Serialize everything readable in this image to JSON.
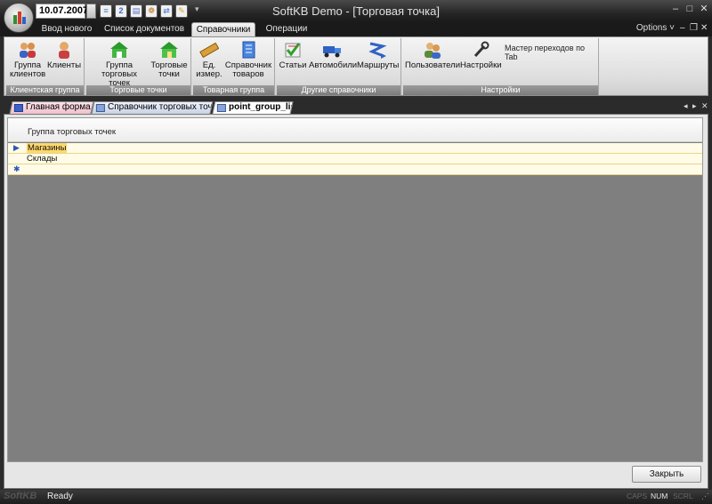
{
  "window": {
    "title": "SoftKB Demo - [Торговая точка]",
    "date": "10.07.2007",
    "minimize": "–",
    "maximize": "□",
    "close": "✕"
  },
  "quick_access": {
    "items": [
      {
        "icon": "document-icon",
        "glyph": "≡",
        "color": "#4f7fd8"
      },
      {
        "icon": "refresh-icon",
        "glyph": "2",
        "color": "#3a6bd0"
      },
      {
        "icon": "print-icon",
        "glyph": "▤",
        "color": "#5577cc"
      },
      {
        "icon": "settings-icon",
        "glyph": "❁",
        "color": "#c07a20"
      },
      {
        "icon": "export-icon",
        "glyph": "⇄",
        "color": "#5a88d8"
      },
      {
        "icon": "notes-icon",
        "glyph": "✎",
        "color": "#d4a32a"
      }
    ],
    "dropdown": "▾"
  },
  "ribbon": {
    "tabs": [
      {
        "label": "Ввод нового"
      },
      {
        "label": "Список документов"
      },
      {
        "label": "Справочники",
        "active": true
      },
      {
        "label": "Операции"
      }
    ],
    "options_label": "Options ˅",
    "mdi_min": "–",
    "mdi_restore": "❐",
    "mdi_close": "✕",
    "groups": [
      {
        "label": "Клиентская группа",
        "buttons": [
          {
            "label1": "Группа",
            "label2": "клиентов",
            "icon": "users-icon"
          },
          {
            "label1": "Клиенты",
            "label2": "",
            "icon": "client-icon"
          }
        ]
      },
      {
        "label": "Торговые точки",
        "buttons": [
          {
            "label1": "Группа",
            "label2": "торговых точек",
            "icon": "store-group-icon"
          },
          {
            "label1": "Торговые",
            "label2": "точки",
            "icon": "store-icon"
          }
        ]
      },
      {
        "label": "Товарная группа",
        "buttons": [
          {
            "label1": "Ед.",
            "label2": "измер.",
            "icon": "ruler-icon"
          },
          {
            "label1": "Справочник",
            "label2": "товаров",
            "icon": "catalog-icon"
          }
        ]
      },
      {
        "label": "Другие справочники",
        "buttons": [
          {
            "label1": "Статьи",
            "label2": "",
            "icon": "articles-icon"
          },
          {
            "label1": "Автомобили",
            "label2": "",
            "icon": "truck-icon"
          },
          {
            "label1": "Маршруты",
            "label2": "",
            "icon": "route-icon"
          }
        ]
      },
      {
        "label": "Настройки",
        "buttons": [
          {
            "label1": "Пользователи",
            "label2": "",
            "icon": "users-settings-icon"
          },
          {
            "label1": "Настройки",
            "label2": "",
            "icon": "wrench-icon"
          }
        ],
        "extra": "Мастер переходов по Tab"
      }
    ]
  },
  "doc_tabs": {
    "items": [
      {
        "label": "Главная форма"
      },
      {
        "label": "Справочник торговых точек"
      },
      {
        "label": "point_group_list",
        "active": true
      }
    ],
    "prev": "◂",
    "next": "▸",
    "close": "✕"
  },
  "grid": {
    "column_header": "Группа торговых точек",
    "rows": [
      {
        "indicator": "▶",
        "text": "Магазины",
        "selected": true
      },
      {
        "indicator": "",
        "text": "Склады",
        "selected": false
      },
      {
        "indicator": "✱",
        "text": "",
        "selected": false
      }
    ],
    "close_label": "Закрыть"
  },
  "status": {
    "logo": "SoftKB",
    "text": "Ready",
    "caps": "CAPS",
    "num": "NUM",
    "scrl": "SCRL",
    "grip": "⋰"
  }
}
